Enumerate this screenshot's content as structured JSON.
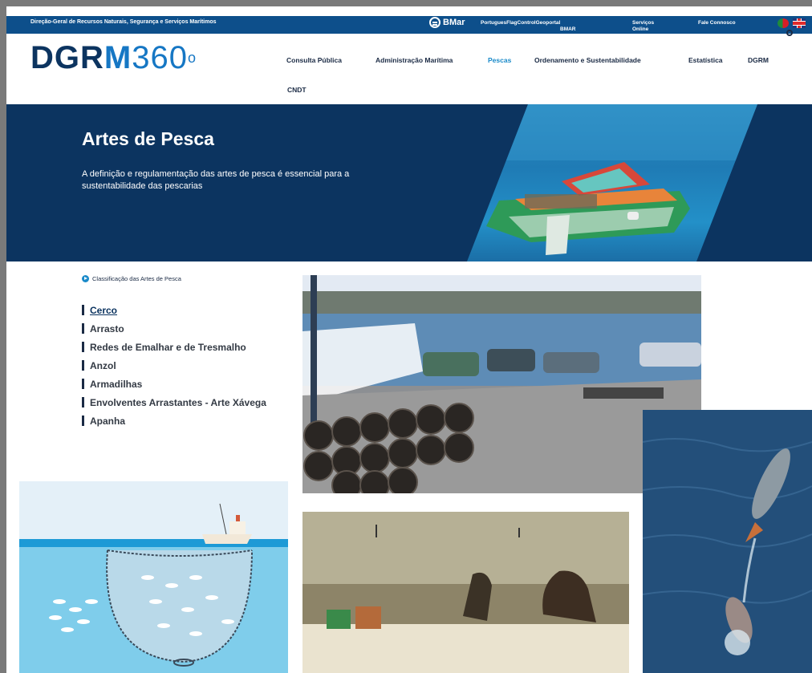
{
  "topbar": {
    "org_name": "Direção-Geral de Recursos Naturais, Segurança e Serviços Marítimos",
    "bmar": "BMar",
    "links": [
      "PortuguesFlagControlGeoportal",
      "BMAR",
      "Serviços Online",
      "Fale Connosco"
    ],
    "flags": [
      "pt-flag-icon",
      "uk-flag-icon"
    ]
  },
  "logo": {
    "dgr": "DGR",
    "m": "M",
    "num": "360",
    "deg": "o"
  },
  "nav": {
    "items": [
      "Consulta Pública",
      "Administração Marítima",
      "Pescas",
      "Ordenamento e Sustentabilidade",
      "Estatística",
      "DGRM",
      "CNDT"
    ],
    "active": "Pescas"
  },
  "hero": {
    "title": "Artes de Pesca",
    "subtitle": "A definição e regulamentação das artes de pesca é essencial para a sustentabilidade das pescarias"
  },
  "classification": {
    "heading": "Classificação das Artes de Pesca",
    "items": [
      "Cerco",
      "Arrasto",
      "Redes de Emalhar e de Tresmalho",
      "Anzol",
      "Armadilhas",
      "Envolventes Arrastantes - Arte Xávega",
      "Apanha"
    ],
    "current": "Cerco"
  },
  "colors": {
    "navy": "#0c3460",
    "accent": "#1a8ac9",
    "topbar": "#0d4f8b"
  }
}
